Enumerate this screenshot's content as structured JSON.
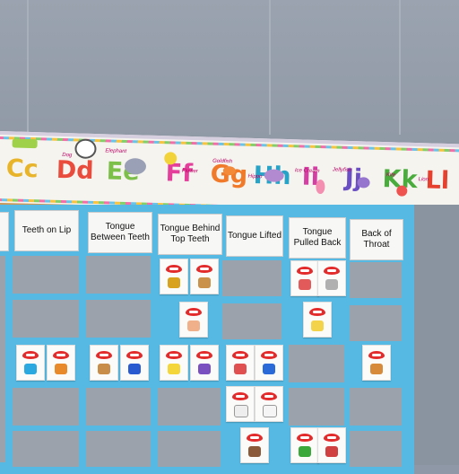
{
  "banner": {
    "letters": [
      "Cc",
      "Dd",
      "Ee",
      "Ff",
      "Gg",
      "Hh",
      "Ii",
      "Jj",
      "Kk",
      "Ll"
    ],
    "words": [
      "Dog",
      "Elephant",
      "Flower",
      "Goldfish",
      "Hippo",
      "Ice Cream",
      "Jellyfish",
      "Kite",
      "Lion"
    ]
  },
  "columns": [
    {
      "label": "Teeth on Lip"
    },
    {
      "label": "Tongue Between Teeth"
    },
    {
      "label": "Tongue Behind Top Teeth"
    },
    {
      "label": "Tongue Lifted"
    },
    {
      "label": "Tongue Pulled Back"
    },
    {
      "label": "Back of Throat"
    }
  ],
  "colors": {
    "grid": "#55b9e3",
    "cell": "#9ba2ac",
    "lips": "#e32b2b",
    "banner": "#f6f4ef"
  }
}
